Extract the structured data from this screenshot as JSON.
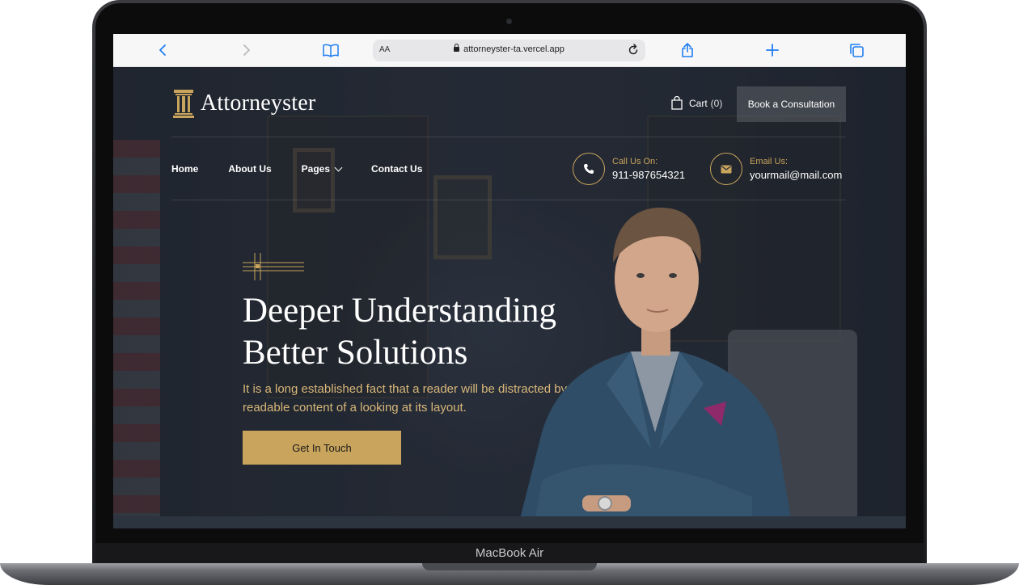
{
  "device": {
    "label": "MacBook Air"
  },
  "browser": {
    "text_size_label": "AA",
    "url": "attorneyster-ta.vercel.app",
    "icons": [
      "back-icon",
      "forward-icon",
      "bookmarks-icon",
      "reload-icon",
      "share-icon",
      "new-tab-icon",
      "tabs-icon"
    ]
  },
  "site": {
    "logo_text": "Attorneyster",
    "cart": {
      "label": "Cart",
      "count": "(0)"
    },
    "book_button": "Book a Consultation",
    "nav": [
      {
        "label": "Home"
      },
      {
        "label": "About Us"
      },
      {
        "label": "Pages"
      },
      {
        "label": "Contact Us"
      }
    ],
    "call": {
      "label": "Call Us On:",
      "value": "911-987654321"
    },
    "email": {
      "label": "Email Us:",
      "value": "yourmail@mail.com"
    },
    "hero": {
      "title_line1": "Deeper Understanding",
      "title_line2": "Better Solutions",
      "subtitle": "It is a long established fact that a reader will be distracted by the readable content of a looking at its layout.",
      "cta": "Get In Touch"
    },
    "colors": {
      "accent": "#c9a45c",
      "background": "#252a33",
      "text": "#ffffff"
    }
  }
}
